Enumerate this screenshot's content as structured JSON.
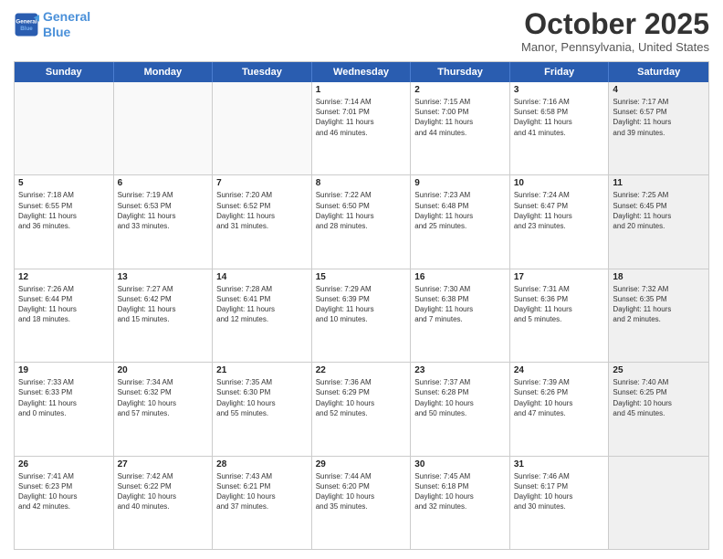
{
  "logo": {
    "line1": "General",
    "line2": "Blue"
  },
  "title": "October 2025",
  "subtitle": "Manor, Pennsylvania, United States",
  "days_of_week": [
    "Sunday",
    "Monday",
    "Tuesday",
    "Wednesday",
    "Thursday",
    "Friday",
    "Saturday"
  ],
  "rows": [
    [
      {
        "day": "",
        "info": "",
        "empty": true
      },
      {
        "day": "",
        "info": "",
        "empty": true
      },
      {
        "day": "",
        "info": "",
        "empty": true
      },
      {
        "day": "1",
        "info": "Sunrise: 7:14 AM\nSunset: 7:01 PM\nDaylight: 11 hours\nand 46 minutes.",
        "empty": false
      },
      {
        "day": "2",
        "info": "Sunrise: 7:15 AM\nSunset: 7:00 PM\nDaylight: 11 hours\nand 44 minutes.",
        "empty": false
      },
      {
        "day": "3",
        "info": "Sunrise: 7:16 AM\nSunset: 6:58 PM\nDaylight: 11 hours\nand 41 minutes.",
        "empty": false
      },
      {
        "day": "4",
        "info": "Sunrise: 7:17 AM\nSunset: 6:57 PM\nDaylight: 11 hours\nand 39 minutes.",
        "empty": false,
        "shaded": true
      }
    ],
    [
      {
        "day": "5",
        "info": "Sunrise: 7:18 AM\nSunset: 6:55 PM\nDaylight: 11 hours\nand 36 minutes.",
        "empty": false
      },
      {
        "day": "6",
        "info": "Sunrise: 7:19 AM\nSunset: 6:53 PM\nDaylight: 11 hours\nand 33 minutes.",
        "empty": false
      },
      {
        "day": "7",
        "info": "Sunrise: 7:20 AM\nSunset: 6:52 PM\nDaylight: 11 hours\nand 31 minutes.",
        "empty": false
      },
      {
        "day": "8",
        "info": "Sunrise: 7:22 AM\nSunset: 6:50 PM\nDaylight: 11 hours\nand 28 minutes.",
        "empty": false
      },
      {
        "day": "9",
        "info": "Sunrise: 7:23 AM\nSunset: 6:48 PM\nDaylight: 11 hours\nand 25 minutes.",
        "empty": false
      },
      {
        "day": "10",
        "info": "Sunrise: 7:24 AM\nSunset: 6:47 PM\nDaylight: 11 hours\nand 23 minutes.",
        "empty": false
      },
      {
        "day": "11",
        "info": "Sunrise: 7:25 AM\nSunset: 6:45 PM\nDaylight: 11 hours\nand 20 minutes.",
        "empty": false,
        "shaded": true
      }
    ],
    [
      {
        "day": "12",
        "info": "Sunrise: 7:26 AM\nSunset: 6:44 PM\nDaylight: 11 hours\nand 18 minutes.",
        "empty": false
      },
      {
        "day": "13",
        "info": "Sunrise: 7:27 AM\nSunset: 6:42 PM\nDaylight: 11 hours\nand 15 minutes.",
        "empty": false
      },
      {
        "day": "14",
        "info": "Sunrise: 7:28 AM\nSunset: 6:41 PM\nDaylight: 11 hours\nand 12 minutes.",
        "empty": false
      },
      {
        "day": "15",
        "info": "Sunrise: 7:29 AM\nSunset: 6:39 PM\nDaylight: 11 hours\nand 10 minutes.",
        "empty": false
      },
      {
        "day": "16",
        "info": "Sunrise: 7:30 AM\nSunset: 6:38 PM\nDaylight: 11 hours\nand 7 minutes.",
        "empty": false
      },
      {
        "day": "17",
        "info": "Sunrise: 7:31 AM\nSunset: 6:36 PM\nDaylight: 11 hours\nand 5 minutes.",
        "empty": false
      },
      {
        "day": "18",
        "info": "Sunrise: 7:32 AM\nSunset: 6:35 PM\nDaylight: 11 hours\nand 2 minutes.",
        "empty": false,
        "shaded": true
      }
    ],
    [
      {
        "day": "19",
        "info": "Sunrise: 7:33 AM\nSunset: 6:33 PM\nDaylight: 11 hours\nand 0 minutes.",
        "empty": false
      },
      {
        "day": "20",
        "info": "Sunrise: 7:34 AM\nSunset: 6:32 PM\nDaylight: 10 hours\nand 57 minutes.",
        "empty": false
      },
      {
        "day": "21",
        "info": "Sunrise: 7:35 AM\nSunset: 6:30 PM\nDaylight: 10 hours\nand 55 minutes.",
        "empty": false
      },
      {
        "day": "22",
        "info": "Sunrise: 7:36 AM\nSunset: 6:29 PM\nDaylight: 10 hours\nand 52 minutes.",
        "empty": false
      },
      {
        "day": "23",
        "info": "Sunrise: 7:37 AM\nSunset: 6:28 PM\nDaylight: 10 hours\nand 50 minutes.",
        "empty": false
      },
      {
        "day": "24",
        "info": "Sunrise: 7:39 AM\nSunset: 6:26 PM\nDaylight: 10 hours\nand 47 minutes.",
        "empty": false
      },
      {
        "day": "25",
        "info": "Sunrise: 7:40 AM\nSunset: 6:25 PM\nDaylight: 10 hours\nand 45 minutes.",
        "empty": false,
        "shaded": true
      }
    ],
    [
      {
        "day": "26",
        "info": "Sunrise: 7:41 AM\nSunset: 6:23 PM\nDaylight: 10 hours\nand 42 minutes.",
        "empty": false
      },
      {
        "day": "27",
        "info": "Sunrise: 7:42 AM\nSunset: 6:22 PM\nDaylight: 10 hours\nand 40 minutes.",
        "empty": false
      },
      {
        "day": "28",
        "info": "Sunrise: 7:43 AM\nSunset: 6:21 PM\nDaylight: 10 hours\nand 37 minutes.",
        "empty": false
      },
      {
        "day": "29",
        "info": "Sunrise: 7:44 AM\nSunset: 6:20 PM\nDaylight: 10 hours\nand 35 minutes.",
        "empty": false
      },
      {
        "day": "30",
        "info": "Sunrise: 7:45 AM\nSunset: 6:18 PM\nDaylight: 10 hours\nand 32 minutes.",
        "empty": false
      },
      {
        "day": "31",
        "info": "Sunrise: 7:46 AM\nSunset: 6:17 PM\nDaylight: 10 hours\nand 30 minutes.",
        "empty": false
      },
      {
        "day": "",
        "info": "",
        "empty": true,
        "shaded": true
      }
    ]
  ]
}
